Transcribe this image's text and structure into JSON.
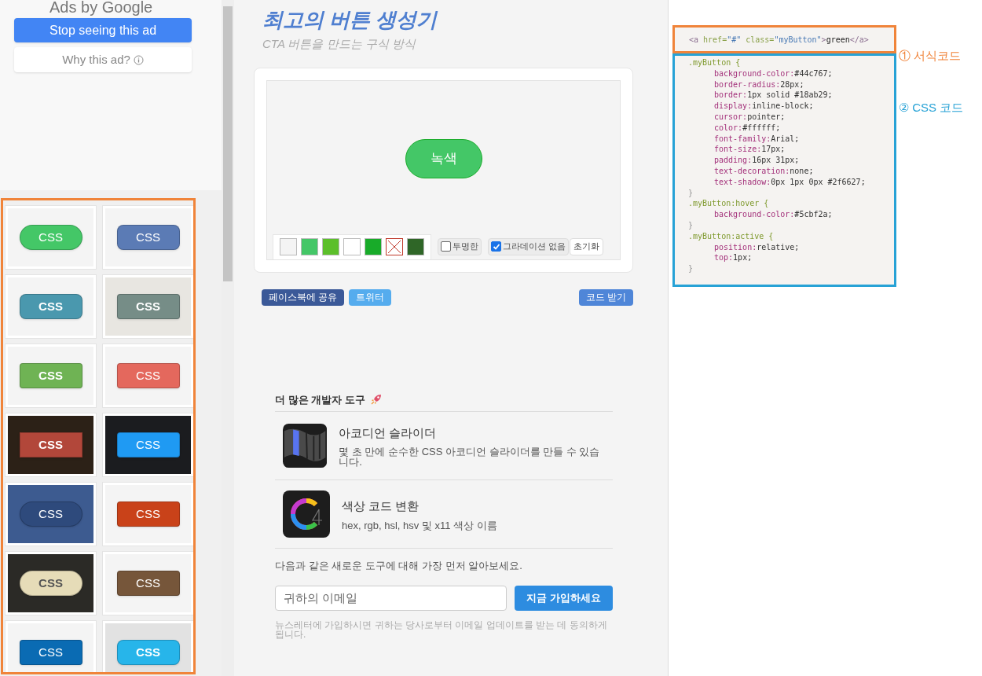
{
  "ad": {
    "brand_line": "Ads by Google",
    "stop_button": "Stop seeing this ad",
    "why_button": "Why this ad?"
  },
  "gallery": [
    {
      "color": "#f4f4f4",
      "button": {
        "label": "CSS",
        "color": "#44c767",
        "kind": "pill",
        "bold": false
      }
    },
    {
      "color": "#f4f4f4",
      "button": {
        "label": "CSS",
        "color": "#5b7bb5",
        "kind": "rounded",
        "bold": false
      }
    },
    {
      "color": "#f4f4f4",
      "button": {
        "label": "CSS",
        "color": "#4a98ae",
        "kind": "rounded",
        "bold": true
      }
    },
    {
      "color": "#e8e6e1",
      "button": {
        "label": "CSS",
        "color": "#768d87",
        "kind": "soft",
        "bold": true
      }
    },
    {
      "color": "#f4f4f4",
      "button": {
        "label": "CSS",
        "color": "#6fb354",
        "kind": "soft",
        "bold": true
      }
    },
    {
      "color": "#f4f4f4",
      "button": {
        "label": "CSS",
        "color": "#e4685d",
        "kind": "soft",
        "bold": false
      }
    },
    {
      "color": "#2c2117",
      "button": {
        "label": "CSS",
        "color": "#b2473a",
        "kind": "square",
        "bold": true
      }
    },
    {
      "color": "#1b1c1f",
      "button": {
        "label": "CSS",
        "color": "#1f9af3",
        "kind": "soft",
        "bold": false
      }
    },
    {
      "color": "#3d5b90",
      "button": {
        "label": "CSS",
        "color": "#2e4a7c",
        "kind": "pill",
        "bold": false
      }
    },
    {
      "color": "#f4f4f4",
      "button": {
        "label": "CSS",
        "color": "#c94219",
        "kind": "soft",
        "bold": false
      }
    },
    {
      "color": "#2b2a26",
      "button": {
        "label": "CSS",
        "color": "#e6dcb8",
        "kind": "pill",
        "bold": true
      }
    },
    {
      "color": "#f4f4f4",
      "button": {
        "label": "CSS",
        "color": "#76563a",
        "kind": "soft",
        "bold": false
      }
    },
    {
      "color": "#f4f4f4",
      "button": {
        "label": "CSS",
        "color": "#0a6bb3",
        "kind": "soft",
        "bold": false
      }
    },
    {
      "color": "#e2e2e2",
      "button": {
        "label": "CSS",
        "color": "#27b5ea",
        "kind": "rounded",
        "bold": true
      }
    }
  ],
  "title": "최고의 버튼 생성기",
  "subtitle": "CTA 버튼을 만드는 구식 방식",
  "preview": {
    "button": {
      "label": "녹색",
      "color": "#44c767"
    },
    "swatches": [
      {
        "kind": "color",
        "color": "#f4f4f4",
        "selected": false
      },
      {
        "kind": "color",
        "color": "#44c767",
        "selected": false
      },
      {
        "kind": "color",
        "color": "#5cbf2a",
        "selected": false
      },
      {
        "kind": "color",
        "color": "#ffffff",
        "selected": false
      },
      {
        "kind": "color",
        "color": "#18ab29",
        "selected": false
      },
      {
        "kind": "none",
        "color": "#ffffff",
        "selected": true
      },
      {
        "kind": "color",
        "color": "#2f6627",
        "selected": false
      }
    ],
    "options": [
      {
        "label": "투명한",
        "checked": false
      },
      {
        "label": "그라데이션 없음",
        "checked": true
      }
    ],
    "reset_button": "초기화"
  },
  "share": {
    "facebook": "페이스북에 공유",
    "twitter": "트위터",
    "get_code": "코드 받기"
  },
  "tools": {
    "heading": "더 많은 개발자 도구",
    "items": [
      {
        "kind": "accordion",
        "name": "아코디언 슬라이더",
        "description": "몇 초 만에 순수한 CSS 아코디언 슬라이더를 만들 수 있습니다."
      },
      {
        "kind": "color",
        "name": "색상 코드 변환",
        "description": "hex, rgb, hsl, hsv 및 x11 색상 이름"
      }
    ],
    "newsletter_text": "다음과 같은 새로운 도구에 대해 가장 먼저 알아보세요.",
    "email_placeholder": "귀하의 이메일",
    "signup_button": "지금 가입하세요",
    "disclaimer": "뉴스레터에 가입하시면 귀하는 당사로부터 이메일 업데이트를 받는 데 동의하게 됩니다."
  },
  "code": {
    "html_line": [
      {
        "kind": "tag",
        "text": "<a "
      },
      {
        "kind": "attr",
        "text": "href="
      },
      {
        "kind": "string",
        "text": "\"#\""
      },
      {
        "kind": "attr",
        "text": " class="
      },
      {
        "kind": "string",
        "text": "\"myButton\""
      },
      {
        "kind": "tag",
        "text": ">"
      },
      {
        "kind": "plain",
        "text": "green"
      },
      {
        "kind": "tag",
        "text": "</a>"
      }
    ],
    "css_lines": [
      {
        "kind": "selector",
        "text": ".myButton {"
      },
      {
        "kind": "property",
        "text": "background-color:#44c767;"
      },
      {
        "kind": "property",
        "text": "border-radius:28px;"
      },
      {
        "kind": "property",
        "text": "border:1px solid #18ab29;"
      },
      {
        "kind": "property",
        "text": "display:inline-block;"
      },
      {
        "kind": "property",
        "text": "cursor:pointer;"
      },
      {
        "kind": "property",
        "text": "color:#ffffff;"
      },
      {
        "kind": "property",
        "text": "font-family:Arial;"
      },
      {
        "kind": "property",
        "text": "font-size:17px;"
      },
      {
        "kind": "property",
        "text": "padding:16px 31px;"
      },
      {
        "kind": "property",
        "text": "text-decoration:none;"
      },
      {
        "kind": "property",
        "text": "text-shadow:0px 1px 0px #2f6627;"
      },
      {
        "kind": "brace",
        "text": "}"
      },
      {
        "kind": "selector",
        "text": ".myButton:hover {"
      },
      {
        "kind": "property",
        "text": "background-color:#5cbf2a;"
      },
      {
        "kind": "brace",
        "text": "}"
      },
      {
        "kind": "selector",
        "text": ".myButton:active {"
      },
      {
        "kind": "property",
        "text": "position:relative;"
      },
      {
        "kind": "property",
        "text": "top:1px;"
      },
      {
        "kind": "brace",
        "text": "}"
      }
    ],
    "annotations": [
      {
        "number": "①",
        "label": "서식코드",
        "color": "#f0843a"
      },
      {
        "number": "②",
        "label": "CSS 코드",
        "color": "#27a2d6"
      }
    ]
  }
}
